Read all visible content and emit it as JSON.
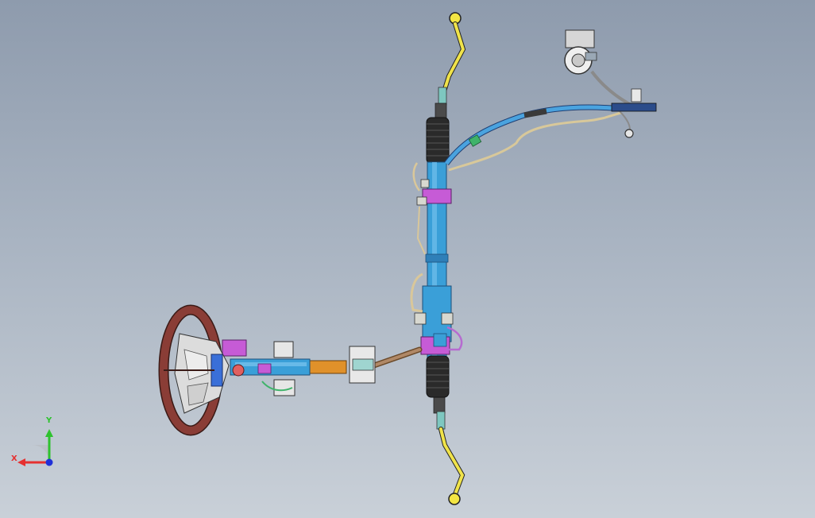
{
  "viewport": {
    "background_top": "#8e9bad",
    "background_bottom": "#c9d0d8"
  },
  "model": {
    "parts": [
      "steering-wheel-icon",
      "steering-column-icon",
      "intermediate-shaft-icon",
      "steering-rack-icon",
      "tie-rod-icon",
      "pressure-hose-icon",
      "return-line-icon",
      "reservoir-icon"
    ],
    "colors": {
      "wheel": "#8a3d36",
      "rack": "#3a9fd8",
      "tie_rod": "#f0e34a",
      "boot": "#2a2a2a",
      "clamp": "#c65bd6",
      "shaft_orange": "#e0912a"
    }
  },
  "triad": {
    "x_label": "X",
    "y_label": "Y",
    "x_color": "#e53030",
    "y_color": "#2ec22e",
    "z_color": "#2030d8"
  }
}
